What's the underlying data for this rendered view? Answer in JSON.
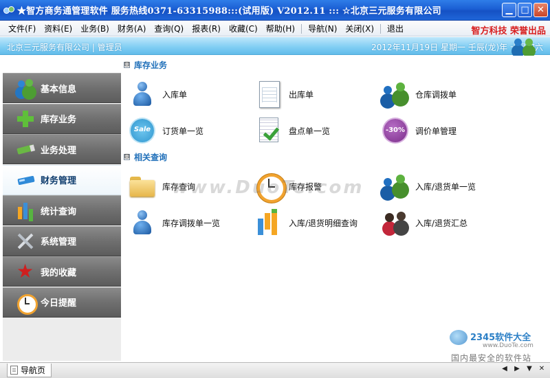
{
  "window": {
    "title": "★智方商务通管理软件 服务热线0371-63315988:::(试用版) V2012.11  :::  ☆北京三元服务有限公司",
    "min_icon": "minimize-icon",
    "max_icon": "maximize-icon",
    "close_icon": "close-icon"
  },
  "menu": {
    "items": [
      "文件(F)",
      "资料(E)",
      "业务(B)",
      "财务(A)",
      "查询(Q)",
      "报表(R)",
      "收藏(C)",
      "帮助(H)",
      "导航(N)",
      "关闭(X)",
      "退出"
    ],
    "brand": "智方科技 荣誉出品"
  },
  "infobar": {
    "left": "北京三元服务有限公司 | 管理员",
    "right": "2012年11月19日  星期一  壬辰(龙)年 十月初六"
  },
  "sidebar": {
    "items": [
      {
        "label": "基本信息",
        "icon": "users-icon"
      },
      {
        "label": "库存业务",
        "icon": "plus-icon"
      },
      {
        "label": "业务处理",
        "icon": "pen-icon"
      },
      {
        "label": "财务管理",
        "icon": "card-icon"
      },
      {
        "label": "统计查询",
        "icon": "chart-icon"
      },
      {
        "label": "系统管理",
        "icon": "tools-icon"
      },
      {
        "label": "我的收藏",
        "icon": "star-icon"
      },
      {
        "label": "今日提醒",
        "icon": "clock-icon"
      }
    ],
    "active_index": 3
  },
  "sections": [
    {
      "title": "库存业务",
      "toggle": "⊟",
      "tiles": [
        {
          "label": "入库单",
          "icon": "person-icon"
        },
        {
          "label": "出库单",
          "icon": "document-icon"
        },
        {
          "label": "仓库调拨单",
          "icon": "users-icon"
        },
        {
          "label": "订货单一览",
          "icon": "sale-icon"
        },
        {
          "label": "盘点单一览",
          "icon": "checklist-icon"
        },
        {
          "label": "调价单管理",
          "icon": "discount-icon"
        }
      ]
    },
    {
      "title": "相关查询",
      "toggle": "⊟",
      "tiles": [
        {
          "label": "库存查询",
          "icon": "folder-icon"
        },
        {
          "label": "库存报警",
          "icon": "clock-icon"
        },
        {
          "label": "入库/退货单一览",
          "icon": "users-icon"
        },
        {
          "label": "库存调拨单一览",
          "icon": "person-icon"
        },
        {
          "label": "入库/退货明细查询",
          "icon": "bar-chart-icon"
        },
        {
          "label": "入库/退货汇总",
          "icon": "people-icon"
        }
      ]
    }
  ],
  "watermarks": {
    "center": "www.DuoTe.com",
    "brand": "2345软件大全",
    "url": "www.DuoTe.com",
    "tagline": "国内最安全的软件站"
  },
  "statusbar": {
    "tab_label": "导航页",
    "ctrls": [
      "◀",
      "▶",
      "▼",
      "✕"
    ]
  }
}
